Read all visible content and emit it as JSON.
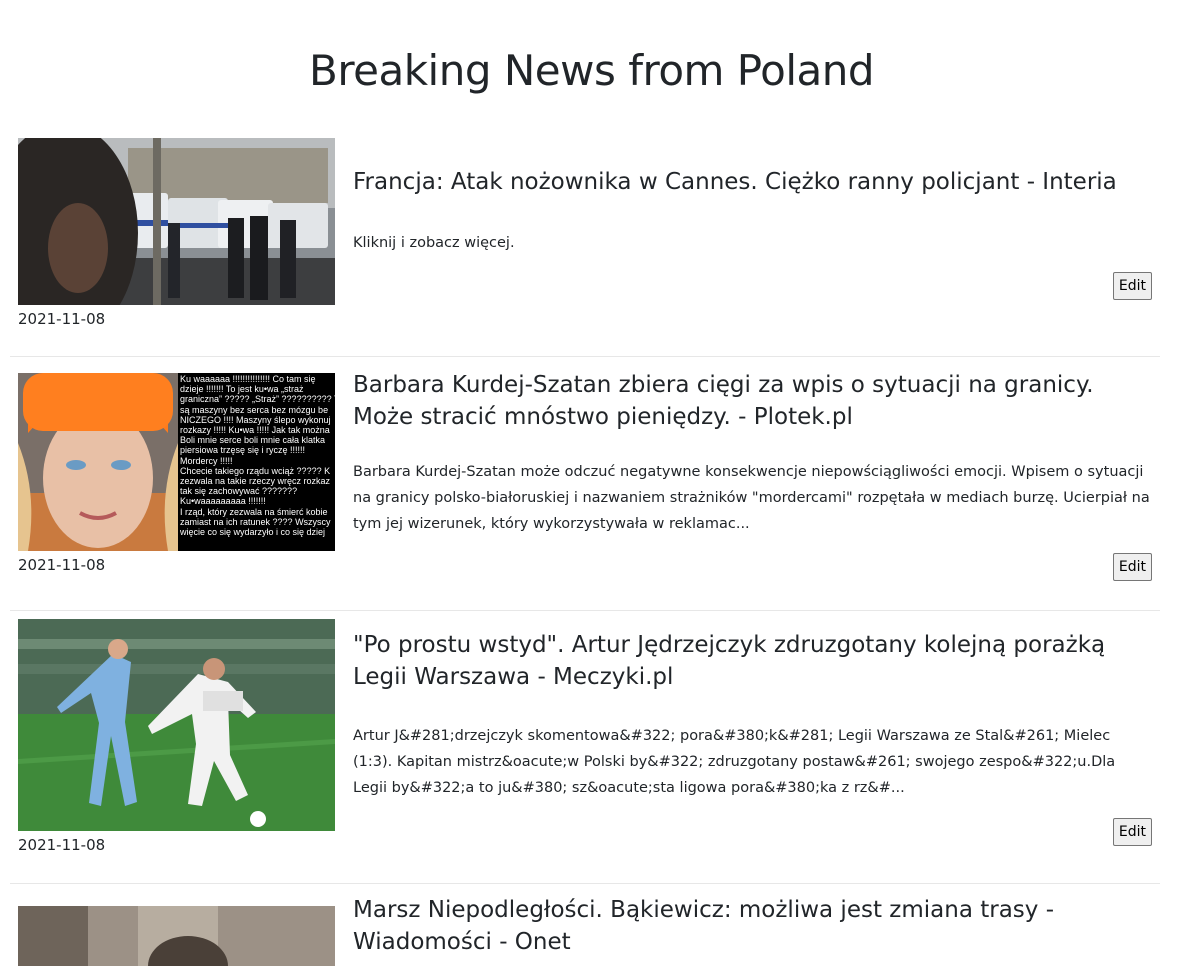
{
  "page": {
    "title": "Breaking News from Poland"
  },
  "articles": [
    {
      "title": "Francja: Atak nożownika w Cannes. Ciężko ranny policjant - Interia",
      "summary": "Kliknij i zobacz więcej.",
      "date": "2021-11-08",
      "edit_label": "Edit",
      "image_icon": "police-vans-photo"
    },
    {
      "title": "Barbara Kurdej-Szatan zbiera cięgi za wpis o sytuacji na granicy. Może stracić mnóstwo pieniędzy. - Plotek.pl",
      "summary": "Barbara Kurdej-Szatan może odczuć negatywne konsekwencje niepowściągliwości emocji. Wpisem o sytuacji na granicy polsko-białoruskiej i nazwaniem strażników \"mordercami\" rozpętała w mediach burzę. Ucierpiał na tym jej wizerunek, który wykorzystywała w reklamac...",
      "date": "2021-11-08",
      "edit_label": "Edit",
      "image_icon": "woman-orange-beanie-photo",
      "image_overlay_text": "Ku waaaaaa !!!!!!!!!!!!!!! Co tam się\ndzieje !!!!!!! To jest ku•wa „straż\ngraniczna” ????? „Straż” ?????????? T\nsą maszyny bez serca bez mózgu be\nNICZEGO !!!! Maszyny ślepo wykonuj\nrozkazy !!!!! Ku•wa !!!!! Jak tak można\nBoli mnie serce boli mnie cała klatka\npiersiowa trzęsę się i ryczę !!!!!!\nMordercy !!!!!\nChcecie takiego rządu wciąż ????? K\nzezwala na takie rzeczy wręcz rozkaz\ntak się zachowywać ???????\nKu•waaaaaaaaa !!!!!!!\nI rząd, który zezwala na śmierć kobie\nzamiast na ich ratunek ???? Wszyscy\nwięcie co się wydarzyło i co się dziej"
    },
    {
      "title": "\"Po prostu wstyd\". Artur Jędrzejczyk zdruzgotany kolejną porażką Legii Warszawa - Meczyki.pl",
      "summary": "Artur J&#281;drzejczyk skomentowa&#322; pora&#380;k&#281; Legii Warszawa ze Stal&#261; Mielec (1:3). Kapitan mistrz&oacute;w Polski by&#322; zdruzgotany postaw&#261; swojego zespo&#322;u.Dla Legii by&#322;a to ju&#380; sz&oacute;sta ligowa pora&#380;ka z rz&#...",
      "date": "2021-11-08",
      "edit_label": "Edit",
      "image_icon": "football-players-photo"
    },
    {
      "title": "Marsz Niepodległości. Bąkiewicz: możliwa jest zmiana trasy - Wiadomości - Onet",
      "image_icon": "news-photo"
    }
  ]
}
